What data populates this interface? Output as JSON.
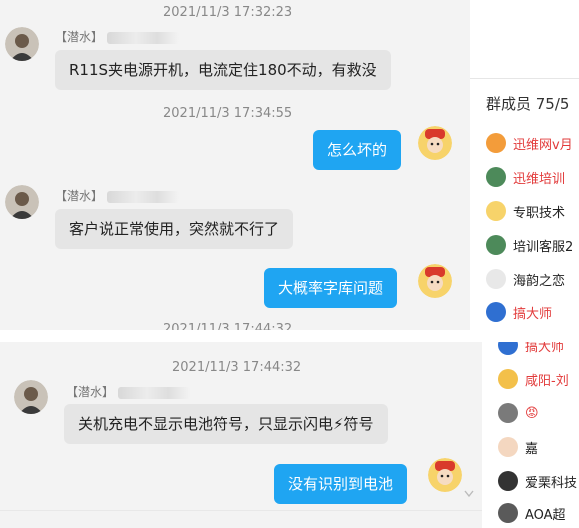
{
  "chat_top": {
    "messages": [
      {
        "timestamp": "2021/11/3 17:32:23",
        "sender": "【潜水】",
        "text": "R11S夹电源开机，电流定住180不动，有救没"
      },
      {
        "timestamp": "2021/11/3 17:34:55",
        "text": "怎么坏的"
      },
      {
        "sender": "【潜水】",
        "text": "客户说正常使用，突然就不行了"
      },
      {
        "text": "大概率字库问题"
      },
      {
        "timestamp": "2021/11/3 17:44:32"
      }
    ]
  },
  "chat_bottom": {
    "messages": [
      {
        "timestamp": "2021/11/3 17:44:32",
        "sender": "【潜水】",
        "text": "关机充电不显示电池符号，只显示闪电⚡符号"
      },
      {
        "text": "没有识别到电池"
      }
    ]
  },
  "sidebar_top": {
    "header": "群成员 75/5",
    "members": [
      {
        "name": "迅维网v月",
        "color": "red"
      },
      {
        "name": "迅维培训",
        "color": "red"
      },
      {
        "name": "专职技术",
        "color": "dark"
      },
      {
        "name": "培训客服2",
        "color": "dark"
      },
      {
        "name": "海韵之恋",
        "color": "dark"
      },
      {
        "name": "搞大师",
        "color": "red"
      }
    ]
  },
  "sidebar_bottom": {
    "members": [
      {
        "name": "搞大师",
        "color": "red"
      },
      {
        "name": "咸阳-刘",
        "color": "red"
      },
      {
        "name": "😡",
        "color": "red"
      },
      {
        "name": "嘉",
        "color": "dark"
      },
      {
        "name": "爱栗科技",
        "color": "dark"
      },
      {
        "name": "AOA超",
        "color": "dark"
      }
    ]
  },
  "icons": [
    "user-avatar-icon",
    "mascot-avatar-icon",
    "collapse-caret-icon"
  ],
  "colors": {
    "bubble_self": "#1fa5f2",
    "bubble_other": "#e5e5e5",
    "member_highlight": "#e23b3b"
  }
}
